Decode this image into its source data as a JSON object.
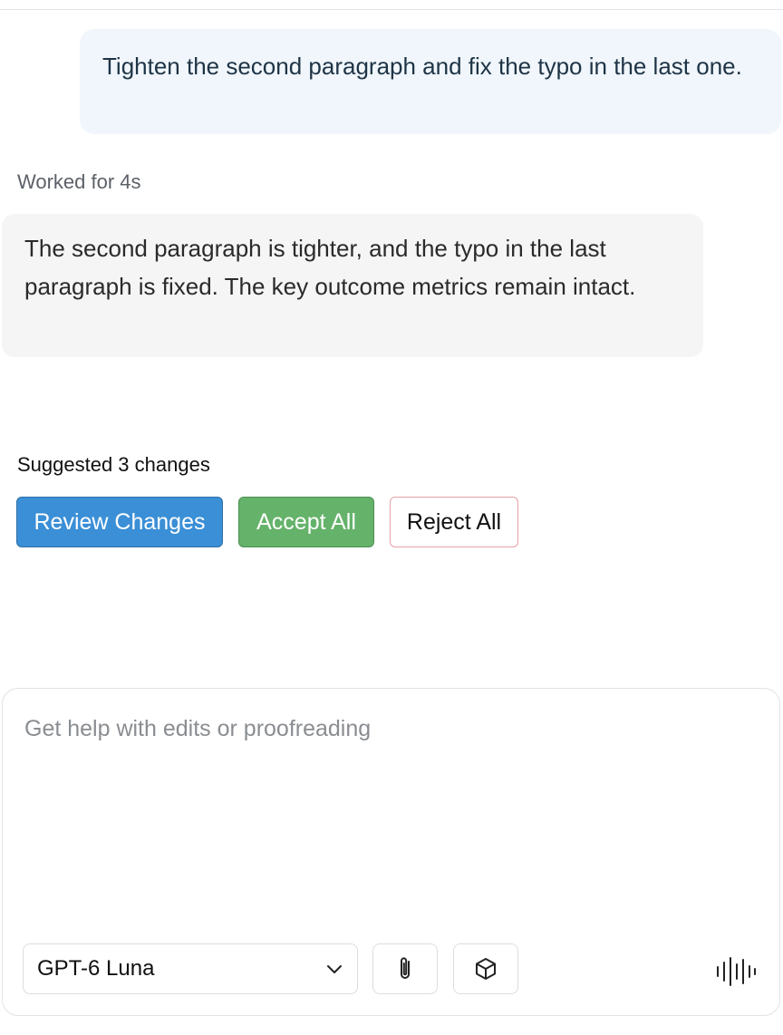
{
  "conversation": {
    "user_message": "Tighten the second paragraph and fix the typo in the last one.",
    "worked_label": "Worked for 4s",
    "assistant_message": "The second paragraph is tighter, and the typo in the last paragraph is fixed. The key outcome metrics remain intact."
  },
  "suggestions": {
    "label": "Suggested 3 changes",
    "review_label": "Review Changes",
    "accept_label": "Accept All",
    "reject_label": "Reject All"
  },
  "composer": {
    "placeholder": "Get help with edits or proofreading",
    "value": "",
    "model_selected": "GPT-6 Luna"
  },
  "icons": {
    "model_dropdown": "chevron-down-icon",
    "attach": "paperclip-icon",
    "context": "cube-icon",
    "voice": "voice-waveform-icon"
  },
  "colors": {
    "user_bubble_bg": "#f0f6fb",
    "assistant_bubble_bg": "#f5f5f5",
    "review_button": "#3b8fd6",
    "accept_button": "#65b26a",
    "reject_border": "#e6a1a6"
  }
}
